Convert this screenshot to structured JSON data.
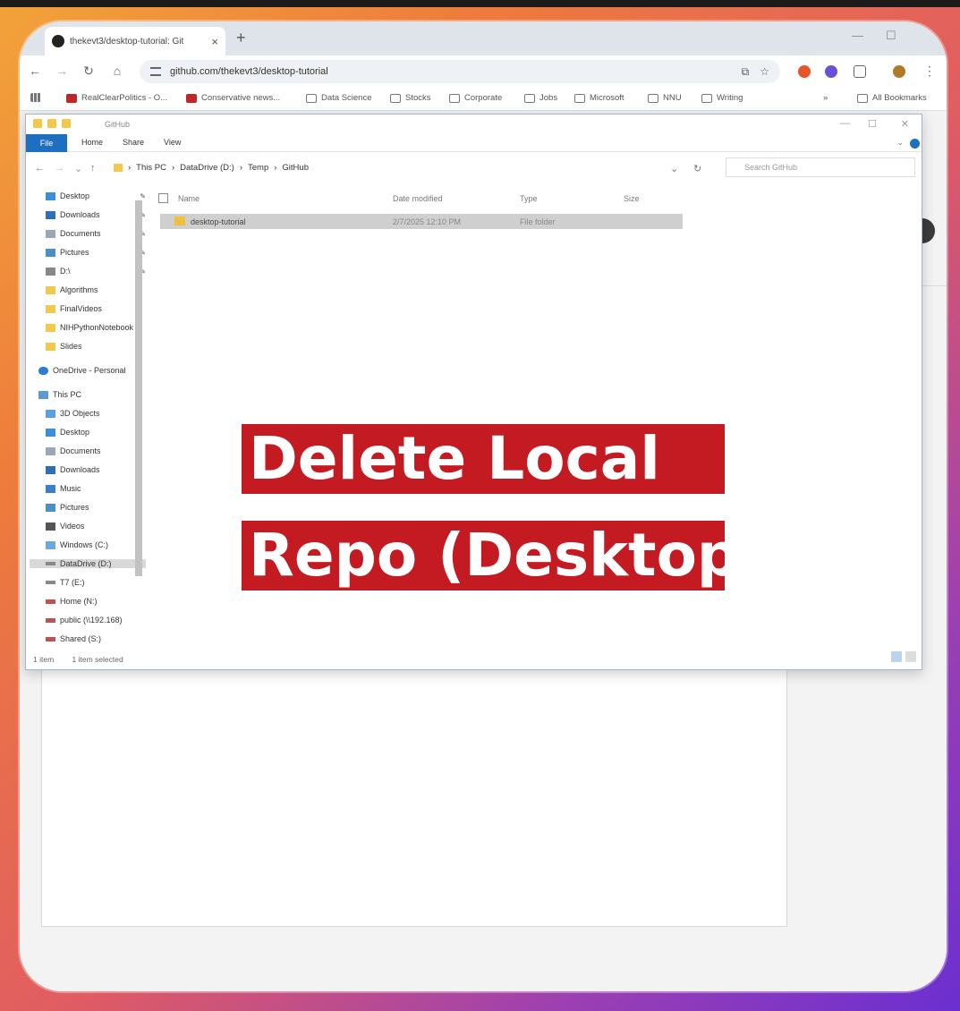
{
  "browser": {
    "tab_title": "thekevt3/desktop-tutorial: Git",
    "tab_close": "×",
    "new_tab": "+",
    "minimize": "—",
    "maximize": "☐",
    "url": "github.com/thekevt3/desktop-tutorial",
    "bookmarks": [
      "RealClearPolitics - O...",
      "Conservative news...",
      "Data Science",
      "Stocks",
      "Corporate",
      "Jobs",
      "Microsoft",
      "NNU",
      "Writing"
    ],
    "overflow": "»",
    "all_bookmarks": "All Bookmarks"
  },
  "explorer": {
    "title": "GitHub",
    "ribbon": {
      "file": "File",
      "home": "Home",
      "share": "Share",
      "view": "View"
    },
    "breadcrumb": [
      "This PC",
      "DataDrive (D:)",
      "Temp",
      "GitHub"
    ],
    "search_placeholder": "Search GitHub",
    "quick_access": [
      "Desktop",
      "Downloads",
      "Documents",
      "Pictures",
      "D:\\",
      "Algorithms",
      "FinalVideos",
      "NIHPythonNotebook",
      "Slides"
    ],
    "onedrive": "OneDrive - Personal",
    "this_pc": "This PC",
    "pc_items": [
      "3D Objects",
      "Desktop",
      "Documents",
      "Downloads",
      "Music",
      "Pictures",
      "Videos",
      "Windows (C:)",
      "DataDrive (D:)",
      "T7 (E:)",
      "Home (N:)",
      "public (\\\\192.168)",
      "Shared (S:)"
    ],
    "columns": {
      "name": "Name",
      "date": "Date modified",
      "type": "Type",
      "size": "Size"
    },
    "files": [
      {
        "name": "desktop-tutorial",
        "date": "2/7/2025 12:10 PM",
        "type": "File folder"
      }
    ],
    "status_items": "1 item",
    "status_selected": "1 item selected"
  },
  "overlay": {
    "line1": "Delete Local",
    "line2": "Repo (Desktop)",
    "color": "#c41a22"
  }
}
